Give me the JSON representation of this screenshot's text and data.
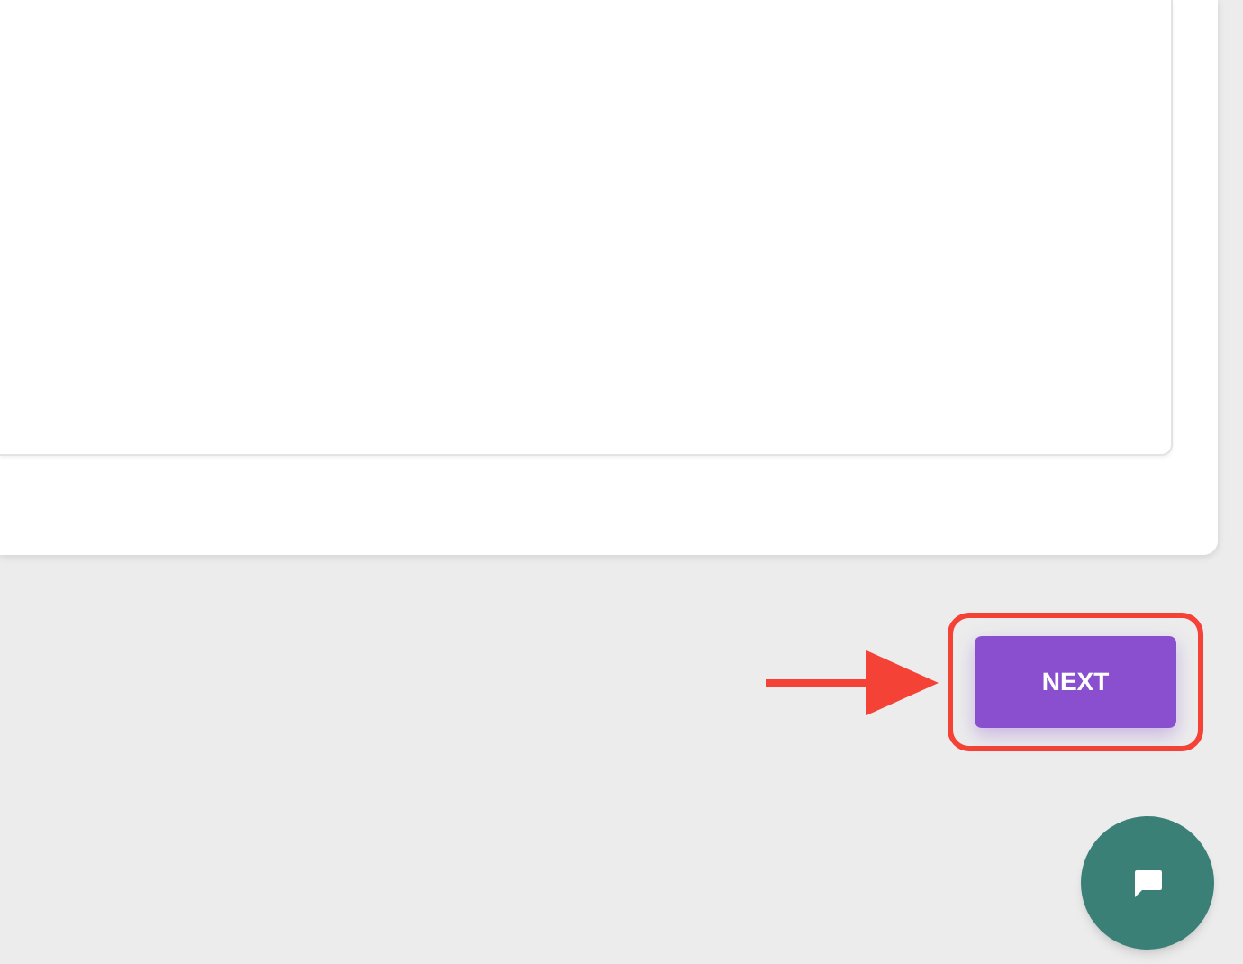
{
  "next_button": {
    "label": "NEXT"
  }
}
